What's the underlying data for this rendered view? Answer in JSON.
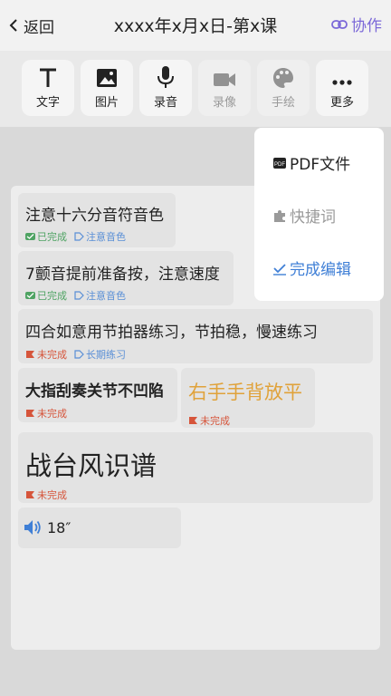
{
  "nav": {
    "back_label": "返回",
    "title": "xxxx年x月x日-第x课",
    "collab_label": "协作"
  },
  "toolbar": {
    "items": [
      {
        "label": "文字",
        "icon": "text-icon",
        "enabled": true
      },
      {
        "label": "图片",
        "icon": "image-icon",
        "enabled": true
      },
      {
        "label": "录音",
        "icon": "microphone-icon",
        "enabled": true
      },
      {
        "label": "录像",
        "icon": "video-camera-icon",
        "enabled": false
      },
      {
        "label": "手绘",
        "icon": "palette-icon",
        "enabled": false
      },
      {
        "label": "更多",
        "icon": "more-dots-icon",
        "enabled": true
      }
    ]
  },
  "notes": [
    {
      "text": "注意十六分音符音色",
      "status": "已完成",
      "tag": "注意音色",
      "style": "normal"
    },
    {
      "text": "7颤音提前准备按，注意速度",
      "status": "已完成",
      "tag": "注意音色",
      "style": "normal"
    },
    {
      "text": "四合如意用节拍器练习，节拍稳，慢速练习",
      "status": "未完成",
      "tag": "长期练习",
      "style": "normal"
    },
    {
      "text": "大指刮奏关节不凹陷",
      "status": "未完成",
      "style": "bold"
    },
    {
      "text": "右手手背放平",
      "status": "未完成",
      "style": "orange-large"
    },
    {
      "text": "战台风识谱",
      "status": "未完成",
      "style": "xlarge"
    }
  ],
  "audio": {
    "duration": "18″",
    "icon": "speaker-icon"
  },
  "menu": {
    "items": [
      {
        "label": "PDF文件",
        "icon": "pdf-icon",
        "color": "#222222"
      },
      {
        "label": "快捷词",
        "icon": "puzzle-piece-icon",
        "color": "#9a9a9a"
      },
      {
        "label": "完成编辑",
        "icon": "checkmark-icon",
        "color": "#3f7fd6"
      }
    ]
  },
  "peek_text": "辑",
  "colors": {
    "accent_purple": "#7b68d8",
    "done_green": "#4fa363",
    "undone_red": "#d6553b",
    "tag_blue": "#5a8fd6",
    "orange": "#e0a23a"
  }
}
